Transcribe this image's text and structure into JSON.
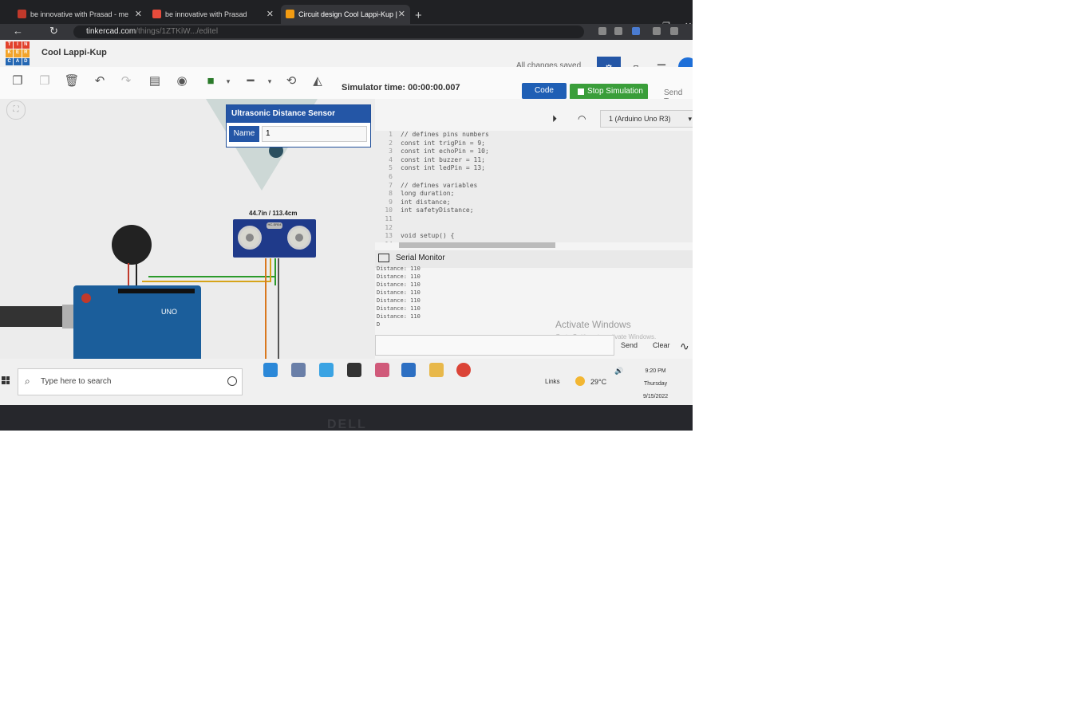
{
  "browser": {
    "tabs": [
      {
        "label": "be innovative with Prasad - me",
        "active": false,
        "favicon_color": "#c0392b"
      },
      {
        "label": "be innovative with Prasad",
        "active": false,
        "favicon_color": "#e74c3c"
      },
      {
        "label": "Circuit design Cool Lappi-Kup |",
        "active": true,
        "favicon_color": "#f39c12"
      }
    ],
    "new_tab": "+",
    "url_host": "tinkercad.com",
    "url_rest": "/things/1ZTKiW.../editel"
  },
  "tinkercad": {
    "logo_letters": [
      "T",
      "I",
      "N",
      "K",
      "E",
      "R",
      "C",
      "A",
      "D"
    ],
    "logo_colors": [
      "#e2412b",
      "#e2412b",
      "#e2412b",
      "#f3a42a",
      "#f3a42a",
      "#f3a42a",
      "#2467b3",
      "#2467b3",
      "#2467b3"
    ],
    "project_name": "Cool Lappi-Kup",
    "save_status": "All changes saved",
    "simulator_time": "Simulator time: 00:00:00.007",
    "code_button": "Code",
    "stop_button": "Stop Simulation",
    "send_to": "Send To"
  },
  "popup": {
    "title": "Ultrasonic Distance Sensor",
    "name_label": "Name",
    "name_value": "1"
  },
  "canvas": {
    "distance_reading": "44.7in / 113.4cm",
    "board_label": "UNO",
    "sensor_label": "HC-SR04"
  },
  "code_panel": {
    "board_select": "1 (Arduino Uno R3)",
    "code_lines": [
      "// defines pins numbers",
      "const int trigPin = 9;",
      "const int echoPin = 10;",
      "const int buzzer = 11;",
      "const int ledPin = 13;",
      "",
      "// defines variables",
      "long duration;",
      "int distance;",
      "int safetyDistance;",
      "",
      "",
      "void setup() {",
      ""
    ],
    "serial_monitor_title": "Serial Monitor",
    "serial_output": [
      "Distance: 110",
      "Distance: 110",
      "Distance: 110",
      "Distance: 110",
      "Distance: 110",
      "Distance: 110",
      "Distance: 110",
      "D"
    ],
    "send_label": "Send",
    "clear_label": "Clear",
    "activate_windows": "Activate Windows",
    "activate_windows_sub": "Go to Settings to activate Windows."
  },
  "taskbar": {
    "search_placeholder": "Type here to search",
    "links_label": "Links",
    "weather": "29°C",
    "time": "9:20 PM",
    "day": "Thursday",
    "date": "9/15/2022"
  },
  "bezel_brand": "DELL",
  "colors": {
    "accent_blue": "#2456a6",
    "stop_green": "#3a9e3a",
    "arduino_blue": "#1b5e9b"
  }
}
